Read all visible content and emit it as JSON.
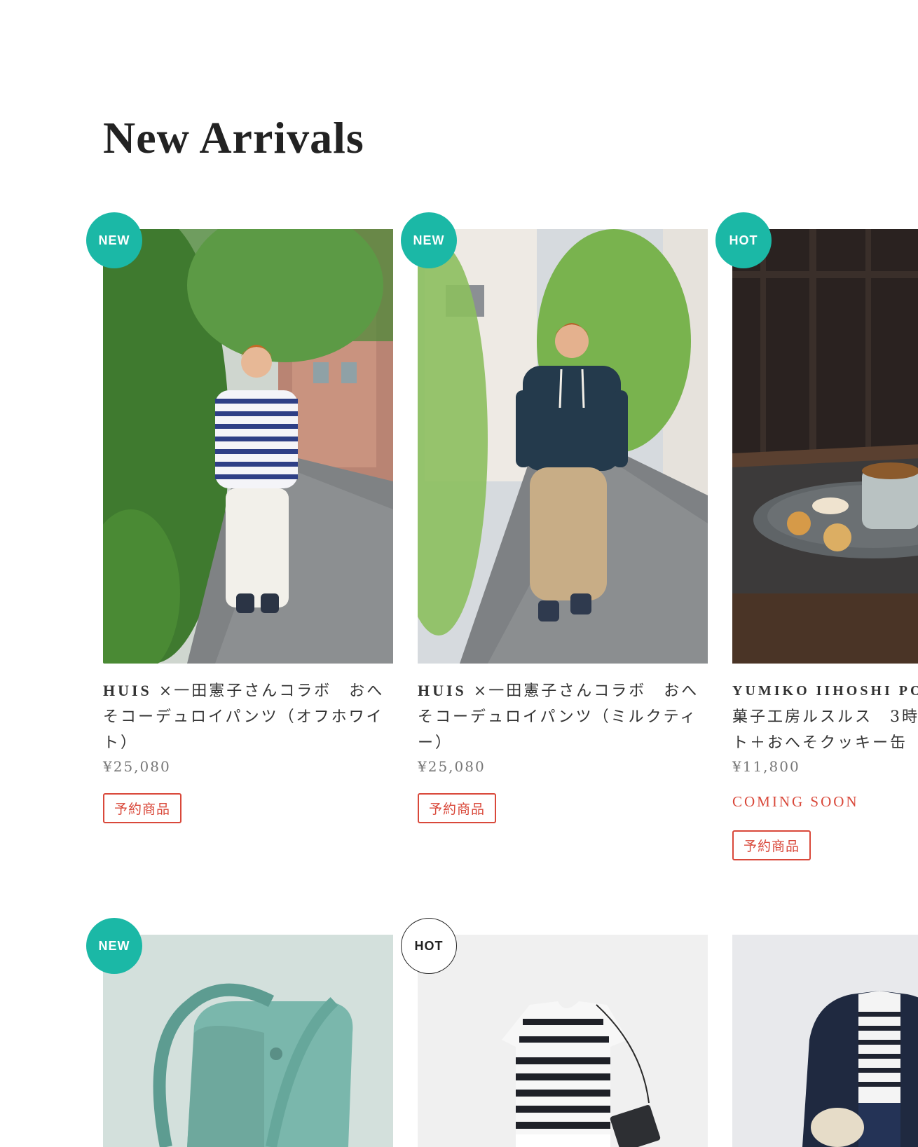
{
  "section": {
    "title": "New Arrivals"
  },
  "products": [
    {
      "badge": "NEW",
      "brand": "HUIS",
      "name": "×一田憲子さんコラボ　おへそコーデュロイパンツ（オフホワイト）",
      "price": "¥25,080",
      "status": "",
      "tag": "予約商品",
      "image": "woman-in-striped-top-white-pants"
    },
    {
      "badge": "NEW",
      "brand": "HUIS",
      "name": "×一田憲子さんコラボ　おへそコーデュロイパンツ（ミルクティー）",
      "price": "¥25,080",
      "status": "",
      "tag": "予約商品",
      "image": "woman-in-navy-hoodie-beige-pants"
    },
    {
      "badge": "HOT",
      "brand": "YUMIKO IIHOSHI PO",
      "name": "菓子工房ルスルス　3時\nト＋おへそクッキー缶",
      "price": "¥11,800",
      "status": "COMING SOON",
      "tag": "予約商品",
      "image": "tea-and-cookies-on-plate"
    },
    {
      "badge": "NEW",
      "image": "green-canvas-bag"
    },
    {
      "badge": "HOT",
      "image": "striped-tshirt-with-pouch"
    },
    {
      "badge": "",
      "image": "navy-cardigan-outfit"
    }
  ]
}
